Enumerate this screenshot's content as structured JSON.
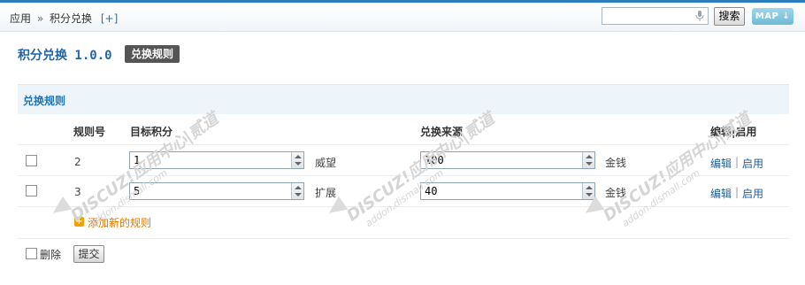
{
  "breadcrumb": {
    "root": "应用",
    "separator": "»",
    "current": "积分兑换",
    "add": "[+]"
  },
  "search": {
    "value": "",
    "button_label": "搜索"
  },
  "map_button": {
    "label": "MAP",
    "icon": "arrow-down-icon"
  },
  "page": {
    "title": "积分兑换 1.0.0",
    "tag": "兑换规则"
  },
  "section": {
    "title": "兑换规则"
  },
  "table": {
    "headers": {
      "rule_no": "规则号",
      "target": "目标积分",
      "source": "兑换来源",
      "actions": "编辑|启用"
    },
    "rows": [
      {
        "rule_no": "2",
        "target_value": "1",
        "target_unit": "威望",
        "source_value": "100",
        "source_unit": "金钱",
        "edit": "编辑",
        "sep": "|",
        "enable": "启用"
      },
      {
        "rule_no": "3",
        "target_value": "5",
        "target_unit": "扩展",
        "source_value": "40",
        "source_unit": "金钱",
        "edit": "编辑",
        "sep": "|",
        "enable": "启用"
      }
    ]
  },
  "add_rule": {
    "icon": "plus-icon",
    "label": "添加新的规则"
  },
  "footer": {
    "delete_label": "删除",
    "submit_label": "提交"
  },
  "watermark": {
    "main": "DISCUZ!应用中心|贰道",
    "sub": "addon.dismall.com"
  }
}
